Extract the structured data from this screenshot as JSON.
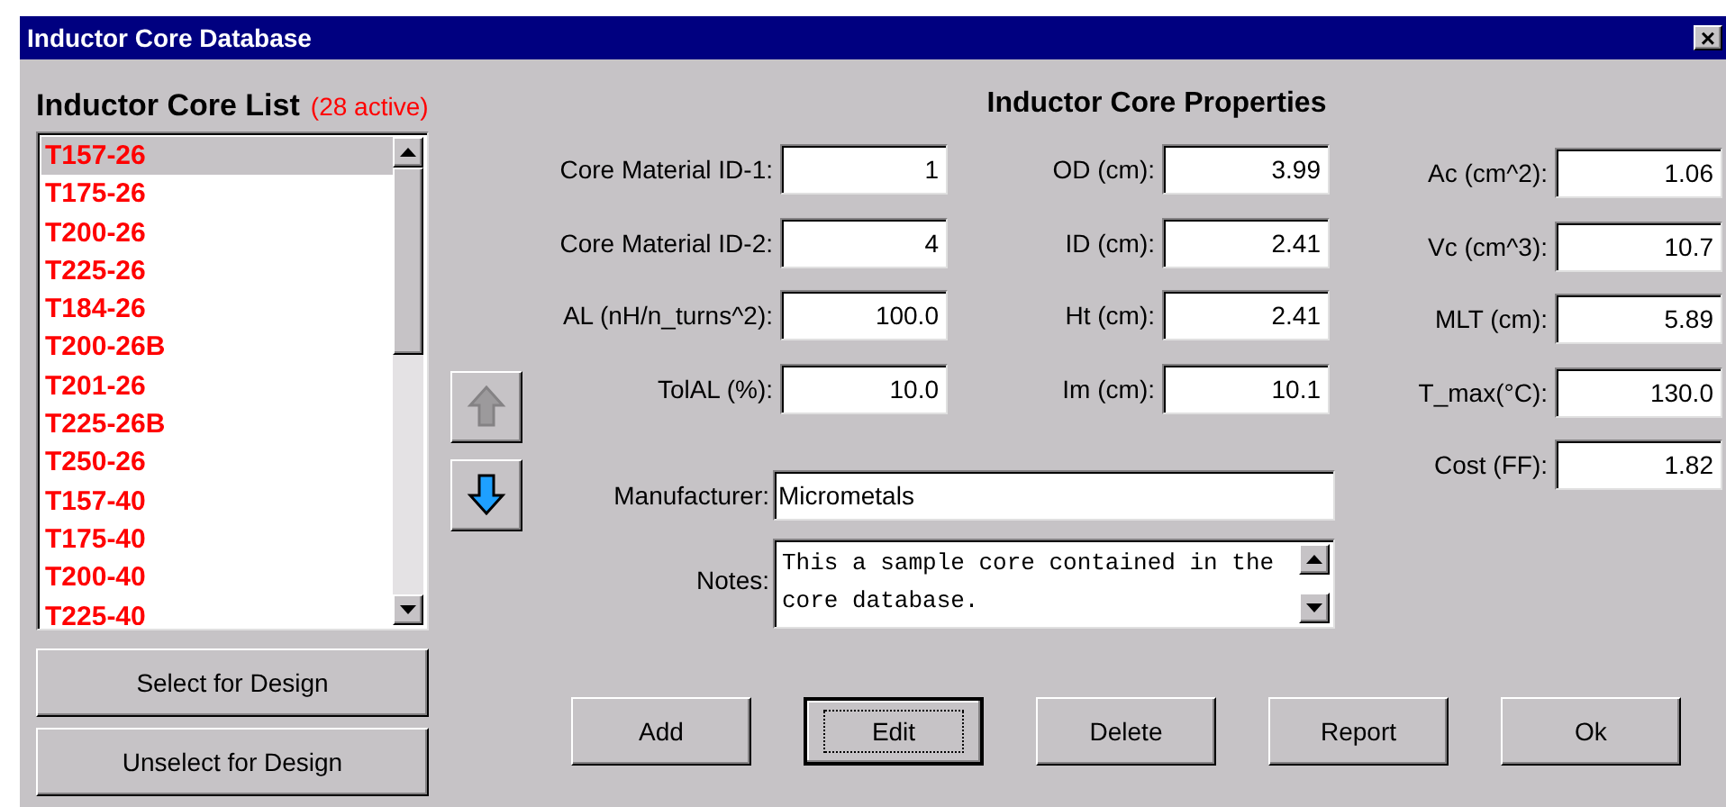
{
  "window": {
    "title": "Inductor Core Database",
    "close": "×"
  },
  "core_list": {
    "title": "Inductor Core List",
    "count": "(28 active)",
    "items": [
      {
        "label": "T157-26",
        "selected": true
      },
      {
        "label": "T175-26",
        "selected": false
      },
      {
        "label": "T200-26",
        "selected": false
      },
      {
        "label": "T225-26",
        "selected": false
      },
      {
        "label": "T184-26",
        "selected": false
      },
      {
        "label": "T200-26B",
        "selected": false
      },
      {
        "label": "T201-26",
        "selected": false
      },
      {
        "label": "T225-26B",
        "selected": false
      },
      {
        "label": "T250-26",
        "selected": false
      },
      {
        "label": "T157-40",
        "selected": false
      },
      {
        "label": "T175-40",
        "selected": false
      },
      {
        "label": "T200-40",
        "selected": false
      },
      {
        "label": "T225-40",
        "selected": false
      }
    ],
    "buttons": [
      "Select for Design",
      "Unselect for Design"
    ]
  },
  "move_buttons": [
    {
      "kind": "up",
      "disabled": true
    },
    {
      "kind": "down",
      "disabled": false
    }
  ],
  "properties": {
    "title": "Inductor Core Properties",
    "columns": [
      [
        {
          "label": "Core Material ID-1:",
          "value": "1"
        },
        {
          "label": "Core Material ID-2:",
          "value": "4"
        },
        {
          "label": "AL (nH/n_turns^2):",
          "value": "100.0"
        },
        {
          "label": "TolAL (%):",
          "value": "10.0"
        }
      ],
      [
        {
          "label": "OD (cm):",
          "value": "3.99"
        },
        {
          "label": "ID (cm):",
          "value": "2.41"
        },
        {
          "label": "Ht (cm):",
          "value": "2.41"
        },
        {
          "label": "Im (cm):",
          "value": "10.1"
        }
      ],
      [
        {
          "label": "Ac (cm^2):",
          "value": "1.06"
        },
        {
          "label": "Vc (cm^3):",
          "value": "10.7"
        },
        {
          "label": "MLT (cm):",
          "value": "5.89"
        },
        {
          "label": "T_max(°C):",
          "value": "130.0"
        },
        {
          "label": "Cost (FF):",
          "value": "1.82"
        }
      ]
    ],
    "manufacturer": {
      "label": "Manufacturer:",
      "value": "Micrometals"
    },
    "notes": {
      "label": "Notes:",
      "value": "This a sample core contained in the core database."
    }
  },
  "buttons": [
    {
      "label": "Add",
      "focused": false
    },
    {
      "label": "Edit",
      "focused": true
    },
    {
      "label": "Delete",
      "focused": false
    },
    {
      "label": "Report",
      "focused": false
    },
    {
      "label": "Ok",
      "focused": false
    }
  ]
}
